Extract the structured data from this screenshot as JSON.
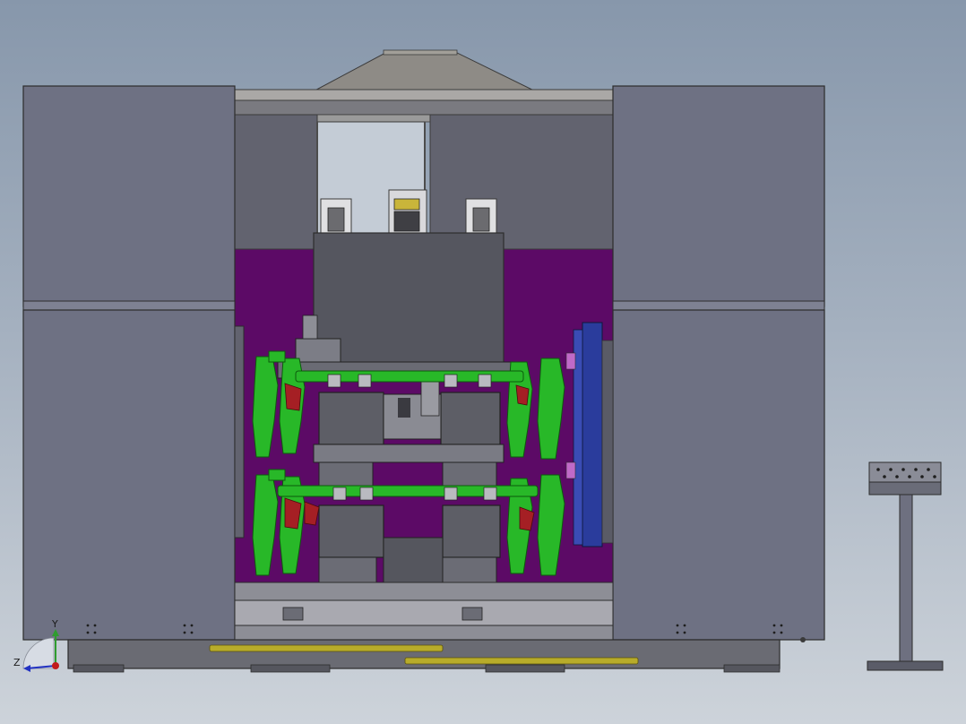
{
  "viewport": {
    "background_top": "#8797ab",
    "background_bottom": "#cdd3da"
  },
  "colors": {
    "panel": "#6e7183",
    "panel_light": "#7a7d8e",
    "frame_dark": "#4a4c57",
    "interior_magenta": "#5c0a66",
    "fixture_green": "#28b828",
    "fixture_green_dark": "#117a11",
    "fixture_red": "#a51f24",
    "blue_plate": "#2a3c9c",
    "yellow_rail": "#b8ac2a",
    "roof": "#8e8b86"
  },
  "triad": {
    "y_label": "Y",
    "z_label": "Z",
    "x_axis_color": "#2f9c2f",
    "z_axis_color": "#2232c2",
    "origin_color": "#c21a1a"
  }
}
